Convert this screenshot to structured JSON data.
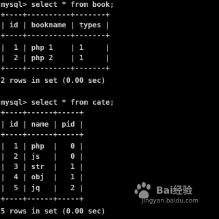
{
  "terminal": {
    "lines": [
      "mysql> select * from book;",
      "+----+----------+-------+",
      "| id | bookname | types |",
      "+----+----------+-------+",
      "|  1 | php 1    | 1     |",
      "|  2 | php 2    | 1     |",
      "+----+----------+-------+",
      "2 rows in set (0.00 sec)",
      "",
      "mysql> select * from cate;",
      "+----+------+-----+",
      "| id | name | pid |",
      "+----+------+-----+",
      "|  1 | php  |   0 |",
      "|  2 | js   |   0 |",
      "|  3 | str  |   1 |",
      "|  4 | obj  |   1 |",
      "|  5 | jq   |   2 |",
      "+----+------+-----+",
      "5 rows in set (0.00 sec)"
    ]
  },
  "watermark": {
    "brand": "Bai经验",
    "url": "jingyan.baidu.com"
  },
  "colors": {
    "background": "#000000",
    "text": "#c8c8c8",
    "watermark": "#8a8a8a"
  }
}
